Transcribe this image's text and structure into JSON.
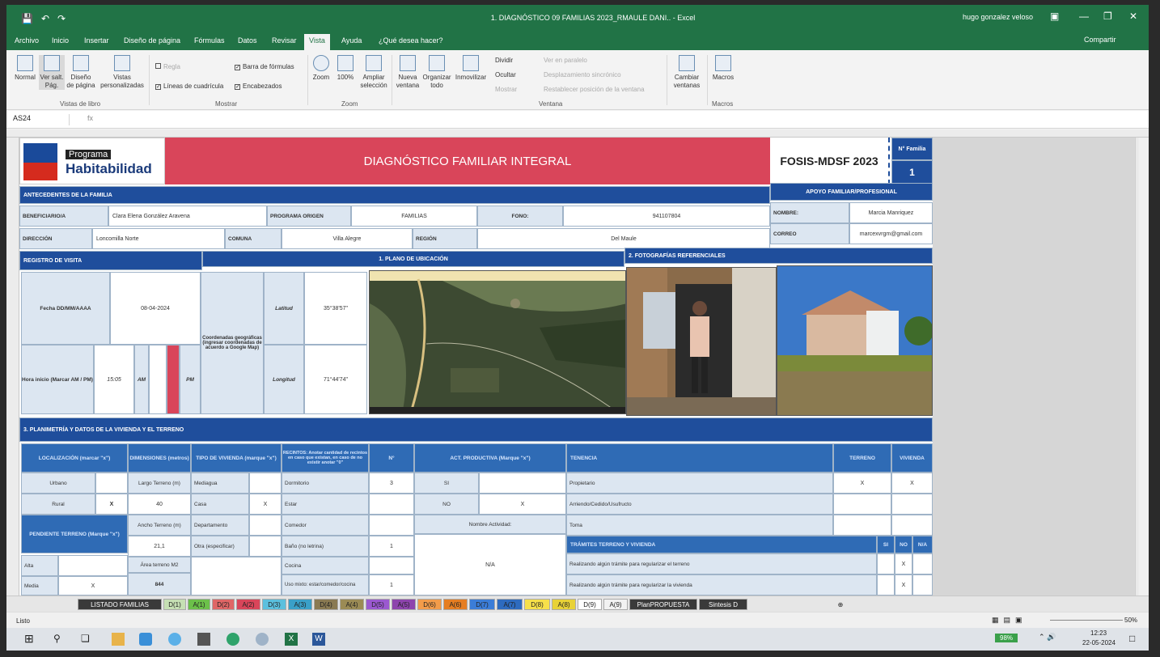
{
  "window": {
    "doc_title": "1. DIAGNÓSTICO 09 FAMILIAS 2023_RMAULE DANI.. - Excel",
    "user": "hugo gonzalez veloso",
    "share": "Compartir"
  },
  "ribbon_tabs": [
    "Archivo",
    "Inicio",
    "Insertar",
    "Diseño de página",
    "Fórmulas",
    "Datos",
    "Revisar",
    "Vista",
    "Ayuda",
    "¿Qué desea hacer?"
  ],
  "ribbon": {
    "normal": "Normal",
    "ver_salt": "Ver salt. Pág.",
    "diseno": "Diseño de página",
    "vistas": "Vistas personalizadas",
    "grp_vistas": "Vistas de libro",
    "regla": "Regla",
    "lineas": "Líneas de cuadrícula",
    "barra": "Barra de fórmulas",
    "encabezados": "Encabezados",
    "grp_mostrar": "Mostrar",
    "zoom": "Zoom",
    "z100": "100%",
    "ampliar": "Ampliar selección",
    "grp_zoom": "Zoom",
    "nueva": "Nueva ventana",
    "organizar": "Organizar todo",
    "inmovilizar": "Inmovilizar",
    "dividir": "Dividir",
    "ocultar": "Ocultar",
    "mostrar": "Mostrar",
    "lado": "Ver en paralelo",
    "desplaz": "Desplazamiento sincrónico",
    "restab": "Restablecer posición de la ventana",
    "grp_ventana": "Ventana",
    "cambiar": "Cambiar ventanas",
    "macros": "Macros",
    "grp_macros": "Macros"
  },
  "formula_bar": {
    "name_box": "AS24",
    "fx": "fx"
  },
  "form": {
    "programa": "Programa",
    "habitabilidad": "Habitabilidad",
    "title": "DIAGNÓSTICO FAMILIAR INTEGRAL",
    "fosis": "FOSIS-MDSF 2023",
    "n_familia_label": "N° Familia",
    "n_familia": "1",
    "antecedentes": "ANTECEDENTES DE LA FAMILIA",
    "apoyo": "APOYO FAMILIAR/PROFESIONAL",
    "beneficiario_lbl": "BENEFICIARIO/A",
    "beneficiario": "Clara Elena González Aravena",
    "programa_origen_lbl": "PROGRAMA ORIGEN",
    "programa_origen": "FAMILIAS",
    "fono_lbl": "FONO:",
    "fono": "941107804",
    "nombre_lbl": "NOMBRE:",
    "nombre": "Marcia Manriquez",
    "direccion_lbl": "DIRECCIÓN",
    "direccion": "Loncomilla Norte",
    "comuna_lbl": "COMUNA",
    "comuna": "Villa Alegre",
    "region_lbl": "REGIÓN",
    "region": "Del Maule",
    "correo_lbl": "CORREO",
    "correo": "marcexvrgm@gmail.com",
    "registro": "REGISTRO DE VISITA",
    "plano": "1. PLANO DE UBICACIÓN",
    "fotos": "2. FOTOGRAFÍAS REFERENCIALES",
    "fecha_lbl": "Fecha DD/MM/AAAA",
    "fecha": "08-04-2024",
    "coord_lbl": "Coordenadas geográficas (ingresar coordenadas de acuerdo a Google Map)",
    "latitud_lbl": "Latitud",
    "latitud": "35°38'57\"",
    "longitud_lbl": "Longitud",
    "longitud": "71°44'74\"",
    "hora_lbl": "Hora inicio (Marcar AM / PM)",
    "hora": "15:05",
    "am": "AM",
    "pm": "PM",
    "planimetria": "3. PLANIMETRÍA Y DATOS DE LA VIVIENDA Y EL TERRENO",
    "localizacion_lbl": "LOCALIZACIÓN (marcar \"x\")",
    "dimensiones_lbl": "DIMENSIONES (metros)",
    "tipo_lbl": "TIPO DE VIVIENDA (marque \"x\")",
    "recintos_lbl": "RECINTOS: Anotar cantidad de recintos en caso que existan, en caso de no existir anotar \"0\"",
    "n_lbl": "N°",
    "act_lbl": "ACT. PRODUCTIVA (Marque \"x\")",
    "tenencia_lbl": "TENENCIA",
    "terreno_lbl": "TERRENO",
    "vivienda_lbl": "VIVIENDA",
    "urbano": "Urbano",
    "rural": "Rural",
    "rural_x": "X",
    "largo_lbl": "Largo Terreno (m)",
    "largo": "40",
    "ancho_lbl": "Ancho Terreno (m)",
    "ancho": "21,1",
    "area_lbl": "Área terreno M2",
    "area": "844",
    "mediagua": "Mediagua",
    "casa": "Casa",
    "casa_x": "X",
    "depto": "Departamento",
    "otra": "Otra (especificar)",
    "dormitorio": "Dormitorio",
    "dormitorio_n": "3",
    "estar": "Estar",
    "comedor": "Comedor",
    "bano": "Baño (no letrina)",
    "bano_n": "1",
    "cocina": "Cocina",
    "mixto": "Uso mixto: estar/comedor/cocina",
    "mixto_n": "1",
    "si": "SI",
    "no": "NO",
    "no_x": "X",
    "nombre_act_lbl": "Nombre Actividad:",
    "na": "N/A",
    "propietario": "Propietario",
    "prop_t": "X",
    "prop_v": "X",
    "arriendo": "Arriendo/Cedido/Usufructo",
    "toma": "Toma",
    "tramites": "TRÁMITES TERRENO Y VIVIENDA",
    "si_col": "SI",
    "no_col": "NO",
    "na_col": "N/A",
    "tram1": "Realizando algún trámite para regularizar el terreno",
    "tram1_x": "X",
    "tram2": "Realizando algún trámite para regularizar la vivienda",
    "tram2_x": "X",
    "pendiente_lbl": "PENDIENTE TERRENO (Marque \"x\")",
    "alta": "Alta",
    "media": "Media",
    "media_x": "X"
  },
  "sheet_tabs": [
    {
      "label": "LISTADO FAMILIAS",
      "color": "#3a3a3a",
      "fg": "#ffffff"
    },
    {
      "label": "D(1)",
      "color": "#c6e0b4",
      "fg": "#222222"
    },
    {
      "label": "A(1)",
      "color": "#6cc04a",
      "fg": "#222222"
    },
    {
      "label": "D(2)",
      "color": "#e06666",
      "fg": "#222222"
    },
    {
      "label": "A(2)",
      "color": "#d9455a",
      "fg": "#222222"
    },
    {
      "label": "D(3)",
      "color": "#5bc0de",
      "fg": "#222222"
    },
    {
      "label": "A(3)",
      "color": "#3aa0c8",
      "fg": "#222222"
    },
    {
      "label": "D(4)",
      "color": "#8a7a52",
      "fg": "#222222"
    },
    {
      "label": "A(4)",
      "color": "#9b8b55",
      "fg": "#222222"
    },
    {
      "label": "D(5)",
      "color": "#9b59d0",
      "fg": "#222222"
    },
    {
      "label": "A(5)",
      "color": "#8e44ad",
      "fg": "#222222"
    },
    {
      "label": "D(6)",
      "color": "#f39c4a",
      "fg": "#222222"
    },
    {
      "label": "A(6)",
      "color": "#e67e22",
      "fg": "#222222"
    },
    {
      "label": "D(7)",
      "color": "#3b7dd8",
      "fg": "#222222"
    },
    {
      "label": "A(7)",
      "color": "#2e6bbf",
      "fg": "#222222"
    },
    {
      "label": "D(8)",
      "color": "#f7e04a",
      "fg": "#222222"
    },
    {
      "label": "A(8)",
      "color": "#e8d238",
      "fg": "#222222"
    },
    {
      "label": "D(9)",
      "color": "#ffffff",
      "fg": "#222222"
    },
    {
      "label": "A(9)",
      "color": "#f2f2f2",
      "fg": "#222222"
    },
    {
      "label": "PlanPROPUESTA",
      "color": "#3a3a3a",
      "fg": "#ffffff"
    },
    {
      "label": "Sintesis D",
      "color": "#3a3a3a",
      "fg": "#ffffff"
    }
  ],
  "status": {
    "ready": "Listo",
    "zoom": "50%"
  },
  "taskbar": {
    "battery": "98%",
    "time": "12:23",
    "date": "22-05-2024"
  }
}
